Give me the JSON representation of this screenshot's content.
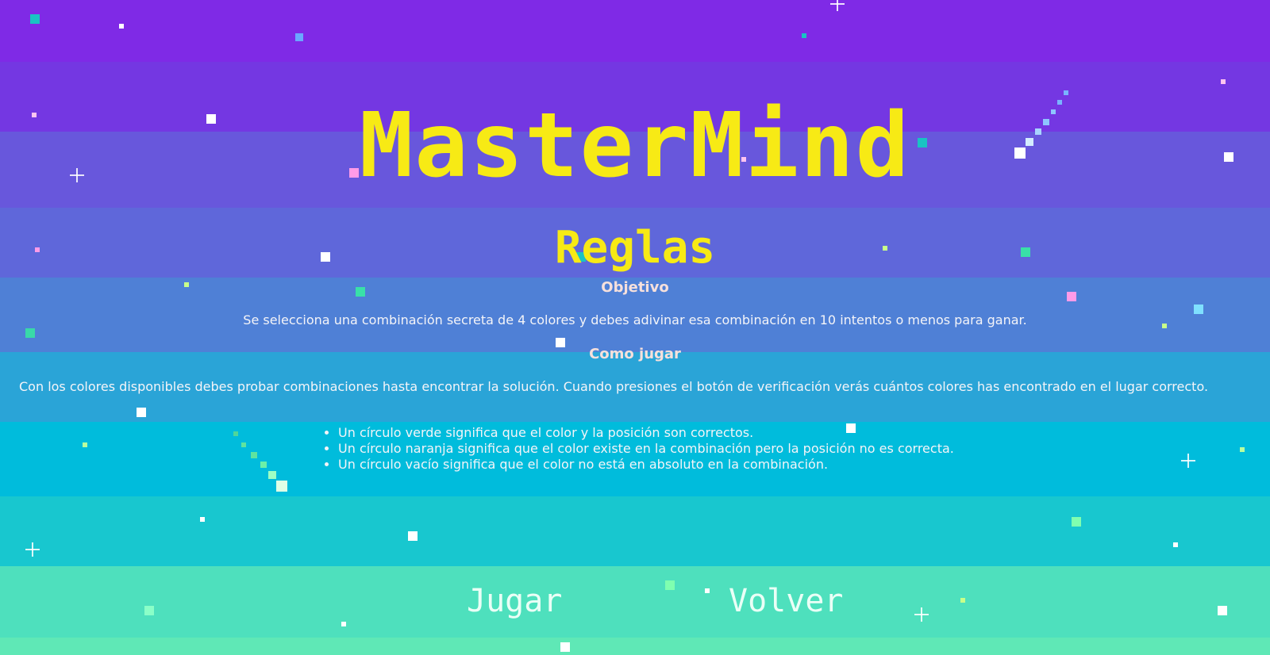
{
  "app": {
    "title": "MasterMind",
    "subtitle": "Reglas"
  },
  "objective": {
    "heading": "Objetivo",
    "text": "Se selecciona una combinación secreta de 4 colores y debes adivinar esa combinación en 10 intentos o menos para ganar."
  },
  "how_to_play": {
    "heading": "Como jugar",
    "text": "Con los colores disponibles debes probar combinaciones hasta encontrar la solución. Cuando presiones el botón de verificación verás cuántos colores has encontrado en el lugar correcto.",
    "rules": [
      "Un círculo verde significa que el color y la posición son correctos.",
      "Un círculo naranja significa que el color existe en la combinación pero la posición no es correcta.",
      "Un círculo vacío significa que el color no está en absoluto en la combinación."
    ]
  },
  "buttons": {
    "play": "Jugar",
    "back": "Volver"
  },
  "colors": {
    "title": "#f7ea15",
    "heading": "#f6e0dc",
    "band_top": "#7f2ae6",
    "band_bottom": "#4ee0bd"
  }
}
